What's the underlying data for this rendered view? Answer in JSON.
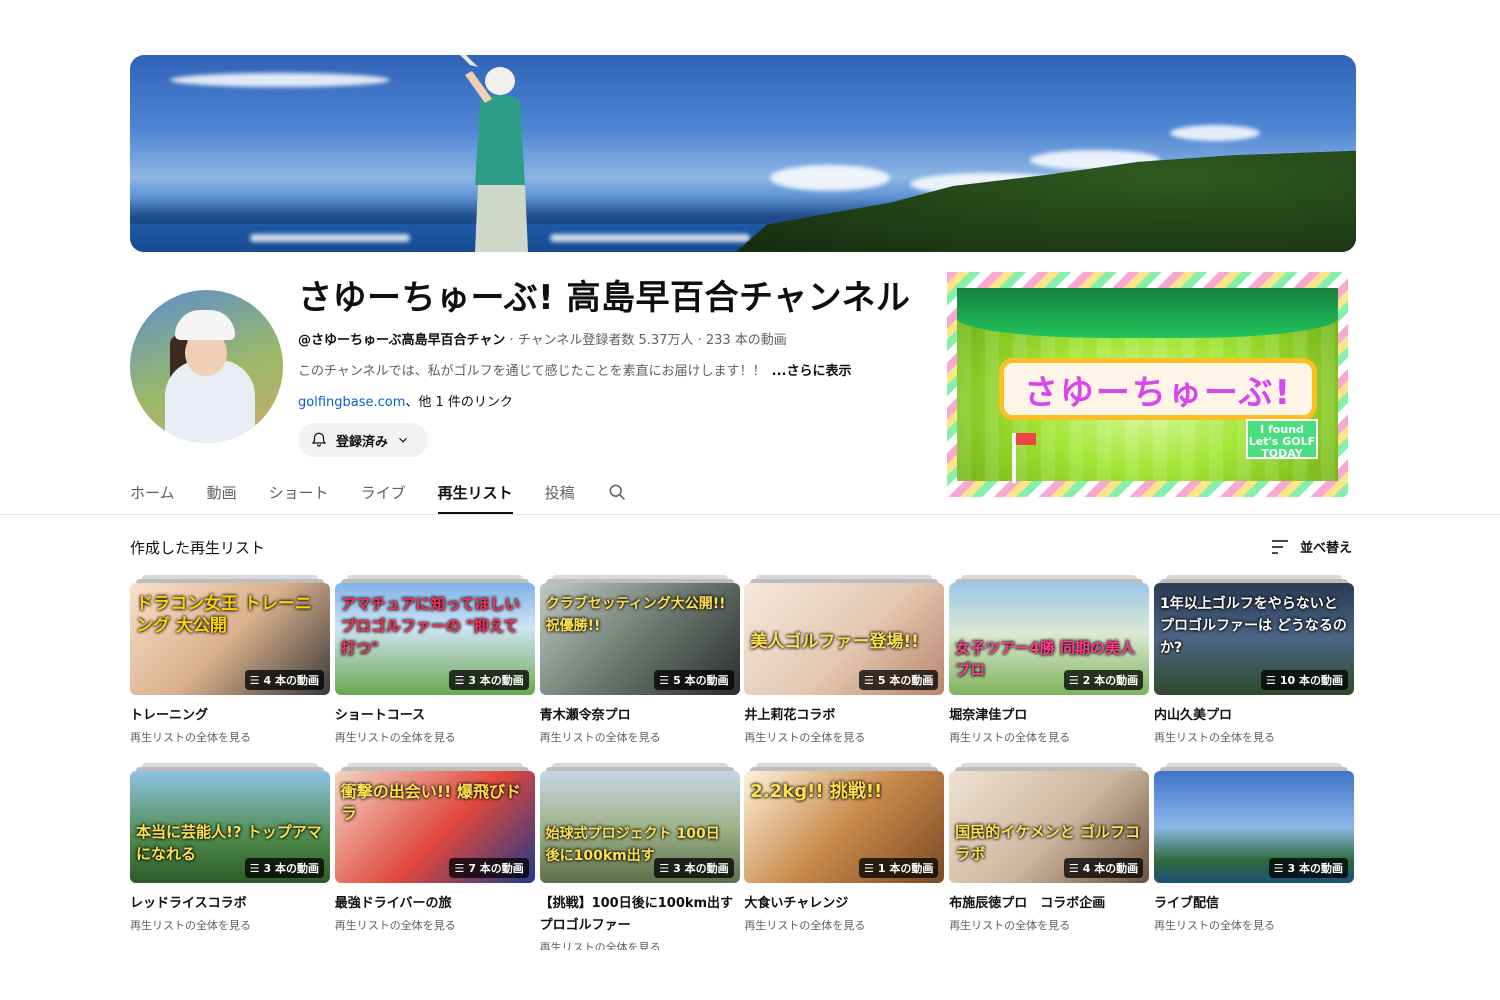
{
  "channel": {
    "name": "さゆーちゅーぶ! 高島早百合チャンネル",
    "handle": "@さゆーちゅーぶ高島早百合チャン",
    "stats": " ‧ チャンネル登録者数 5.37万人 ‧ 233 本の動画",
    "description": "このチャンネルでは、私がゴルフを通じて感じたことを素直にお届けします！！",
    "more_label": "...さらに表示",
    "link_text": "golfingbase.com",
    "other_links": "、他 1 件のリンク",
    "subscribe_label": "登録済み"
  },
  "promo": {
    "title": "さゆーちゅーぶ!",
    "badge_line1": "I found",
    "badge_line2": "Let's GOLF",
    "badge_line3": "TODAY"
  },
  "tabs": [
    {
      "label": "ホーム"
    },
    {
      "label": "動画"
    },
    {
      "label": "ショート"
    },
    {
      "label": "ライブ"
    },
    {
      "label": "再生リスト",
      "active": true
    },
    {
      "label": "投稿"
    }
  ],
  "section": {
    "title": "作成した再生リスト",
    "sort_label": "並べ替え"
  },
  "playlists_row1": [
    {
      "title": "トレーニング",
      "sub": "再生リストの全体を見る",
      "count": "4 本の動画",
      "caption": "ドラコン女王 トレーニング 大公開"
    },
    {
      "title": "ショートコース",
      "sub": "再生リストの全体を見る",
      "count": "3 本の動画",
      "caption": "アマチュアに知ってほしい プロゴルファーの \"抑えて打つ\""
    },
    {
      "title": "青木瀬令奈プロ",
      "sub": "再生リストの全体を見る",
      "count": "5 本の動画",
      "caption": "クラブセッティング大公開!! 祝優勝!!"
    },
    {
      "title": "井上莉花コラボ",
      "sub": "再生リストの全体を見る",
      "count": "5 本の動画",
      "caption": "美人ゴルファー登場!!"
    },
    {
      "title": "堀奈津佳プロ",
      "sub": "再生リストの全体を見る",
      "count": "2 本の動画",
      "caption": "女子ツアー4勝 同期の美人プロ"
    },
    {
      "title": "内山久美プロ",
      "sub": "再生リストの全体を見る",
      "count": "10 本の動画",
      "caption": "1年以上ゴルフをやらないと プロゴルファーは どうなるのか?"
    }
  ],
  "playlists_row2": [
    {
      "title": "レッドライスコラボ",
      "sub": "再生リストの全体を見る",
      "count": "3 本の動画",
      "caption": "本当に芸能人!? トップアマになれる"
    },
    {
      "title": "最強ドライバーの旅",
      "sub": "再生リストの全体を見る",
      "count": "7 本の動画",
      "caption": "衝撃の出会い!! 爆飛びドラ"
    },
    {
      "title": "【挑戦】100日後に100km出すプロゴルファー",
      "sub": "再生リストの全体を見る",
      "count": "3 本の動画",
      "caption": "始球式プロジェクト 100日後に100km出す"
    },
    {
      "title": "大食いチャレンジ",
      "sub": "再生リストの全体を見る",
      "count": "1 本の動画",
      "caption": "2.2kg!! 挑戦!!"
    },
    {
      "title": "布施辰徳プロ　コラボ企画",
      "sub": "再生リストの全体を見る",
      "count": "4 本の動画",
      "caption": "国民的イケメンと ゴルフコラボ"
    },
    {
      "title": "ライブ配信",
      "sub": "再生リストの全体を見る",
      "count": "3 本の動画",
      "caption": ""
    }
  ],
  "colors": {
    "accent": "#0f0f0f",
    "link": "#065fd4",
    "muted": "#606060"
  }
}
